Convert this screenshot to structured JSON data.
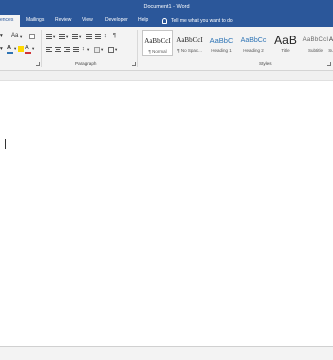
{
  "window": {
    "title": "Document1 - Word"
  },
  "tabs": [
    {
      "label": "ences"
    },
    {
      "label": "Mailings"
    },
    {
      "label": "Review"
    },
    {
      "label": "View"
    },
    {
      "label": "Developer"
    },
    {
      "label": "Help"
    }
  ],
  "tell_me": {
    "text": "Tell me what you want to do"
  },
  "ribbon": {
    "font_group": {
      "size_grow_label": "Aa"
    },
    "paragraph_group": {
      "label": "Paragraph"
    },
    "styles_group": {
      "label": "Styles",
      "items": [
        {
          "sample": "AaBbCcI",
          "name": "¶ Normal",
          "selected": true
        },
        {
          "sample": "AaBbCcI",
          "name": "¶ No Spac..."
        },
        {
          "sample": "AaBbC",
          "name": "Heading 1"
        },
        {
          "sample": "AaBbCc",
          "name": "Heading 2"
        },
        {
          "sample": "AaB",
          "name": "Title"
        },
        {
          "sample": "AaBbCcI",
          "name": "Subtitle"
        },
        {
          "sample": "A",
          "name": "Su"
        }
      ]
    }
  },
  "icons": {
    "styles_scroll": "chevron-down-icon",
    "bulb": "lightbulb-icon"
  },
  "colors": {
    "title_bar": "#2b579a",
    "ribbon": "#f3f3f3",
    "heading_blue": "#2e74b5",
    "font_color_red": "#d13438",
    "highlight_yellow": "#ffd800"
  }
}
